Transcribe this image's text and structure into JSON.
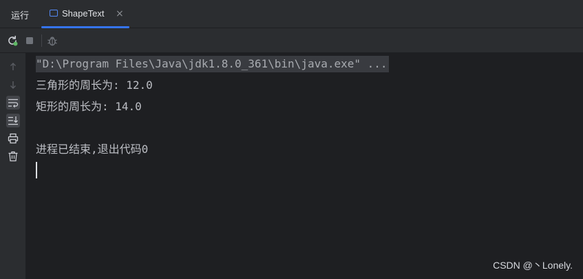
{
  "tabbar": {
    "run_label": "运行",
    "active_tab": {
      "label": "ShapeText",
      "icon": "console-window-icon",
      "close_glyph": "×"
    }
  },
  "toolbar": {
    "buttons": [
      {
        "name": "rerun-icon",
        "state": "enabled"
      },
      {
        "name": "stop-icon",
        "state": "disabled"
      },
      {
        "name": "debug-icon",
        "state": "disabled"
      }
    ]
  },
  "gutter": {
    "buttons": [
      {
        "name": "up-arrow-icon",
        "state": "disabled"
      },
      {
        "name": "down-arrow-icon",
        "state": "disabled"
      },
      {
        "name": "soft-wrap-icon",
        "state": "active"
      },
      {
        "name": "scroll-to-end-icon",
        "state": "active"
      },
      {
        "name": "print-icon",
        "state": "enabled"
      },
      {
        "name": "trash-icon",
        "state": "enabled"
      }
    ]
  },
  "console": {
    "lines": [
      "\"D:\\Program Files\\Java\\jdk1.8.0_361\\bin\\java.exe\" ...",
      "三角形的周长为: 12.0",
      "矩形的周长为: 14.0",
      "",
      "进程已结束,退出代码0"
    ]
  },
  "watermark": "CSDN @丶Lonely.",
  "colors": {
    "accent": "#3574f0",
    "background": "#1e1f22",
    "panel": "#2b2d30"
  }
}
